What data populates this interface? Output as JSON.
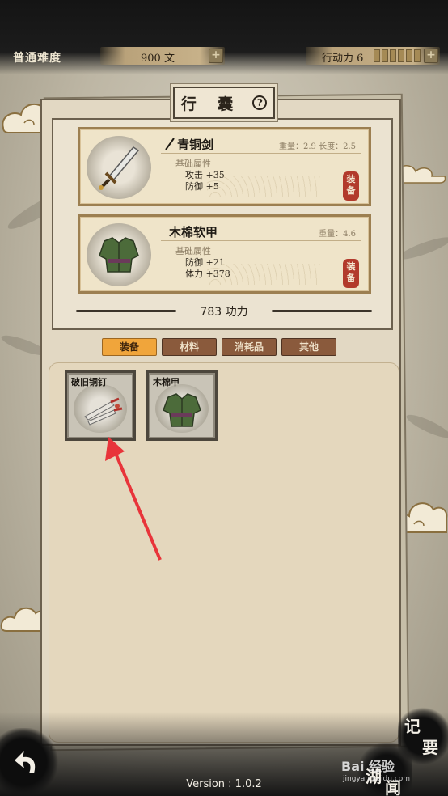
{
  "topbar": {
    "difficulty": "普通难度",
    "money": "900 文",
    "action_points_label": "行动力 6",
    "plus_symbol": "+"
  },
  "panel": {
    "title": "行 囊",
    "help_symbol": "?",
    "equipped": [
      {
        "name": "青铜剑",
        "stats_top": "重量：2.9  长度：2.5",
        "attr_head": "基础属性",
        "attrs": [
          "攻击 +35",
          "防御 +5"
        ],
        "equip_label_1": "装",
        "equip_label_2": "备"
      },
      {
        "name": "木棉软甲",
        "stats_top": "重量：4.6",
        "attr_head": "基础属性",
        "attrs": [
          "防御 +21",
          "体力 +378"
        ],
        "equip_label_1": "装",
        "equip_label_2": "备"
      }
    ],
    "power": "783 功力"
  },
  "tabs": [
    {
      "label": "装备",
      "active": true
    },
    {
      "label": "材料",
      "active": false
    },
    {
      "label": "消耗品",
      "active": false
    },
    {
      "label": "其他",
      "active": false
    }
  ],
  "inventory": [
    {
      "name": "破旧铜钉",
      "icon": "dart-icon"
    },
    {
      "name": "木棉甲",
      "icon": "armor-icon"
    }
  ],
  "bottom": {
    "version": "Version : 1.0.2",
    "record_1": "记",
    "record_2": "要",
    "news_1": "湖",
    "news_2": "闻",
    "watermark": "Bai 经验",
    "watermark_sub": "jingyan.baidu.com"
  },
  "colors": {
    "active_tab": "#f0a53b",
    "inactive_tab": "#8a5a3c",
    "equip_button": "#b23a2c",
    "card_border": "#9c7f51",
    "annotation_arrow": "#e8343a"
  }
}
